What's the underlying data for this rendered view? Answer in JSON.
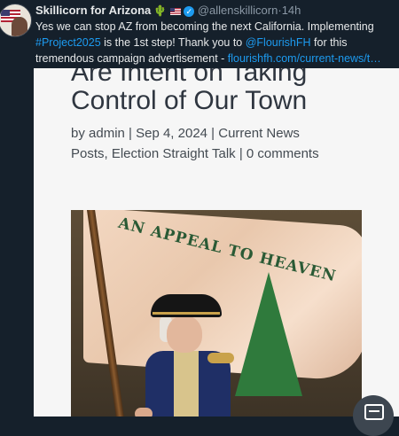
{
  "tweet": {
    "author_name": "Skillicorn for Arizona",
    "handle": "@allenskillicorn",
    "separator": "·",
    "time": "14h",
    "text_part1": "Yes we can stop AZ from becoming the next California. Implementing ",
    "hashtag": "#Project2025",
    "text_part2": " is the 1st step! Thank you to ",
    "mention": "@FlourishFH",
    "text_part3": " for this tremendous campaign advertisement - ",
    "link": "flourishfh.com/current-news/t…",
    "icons": [
      "cactus-icon",
      "us-flag-icon",
      "verified-badge-icon"
    ]
  },
  "article": {
    "title_line1": "Are Intent on Taking",
    "title_line2": "Control of Our Town",
    "meta_line1": "by admin | Sep 4, 2024 | Current News",
    "meta_line2": "Posts, Election Straight Talk | 0 comments",
    "image_flag_text": "AN APPEAL TO HEAVEN"
  },
  "colors": {
    "background": "#15202b",
    "link": "#1d9bf0",
    "text": "#e7e9ea",
    "secondary_text": "#8b98a5"
  },
  "controls": {
    "scan_icon": "text-scan-icon"
  }
}
